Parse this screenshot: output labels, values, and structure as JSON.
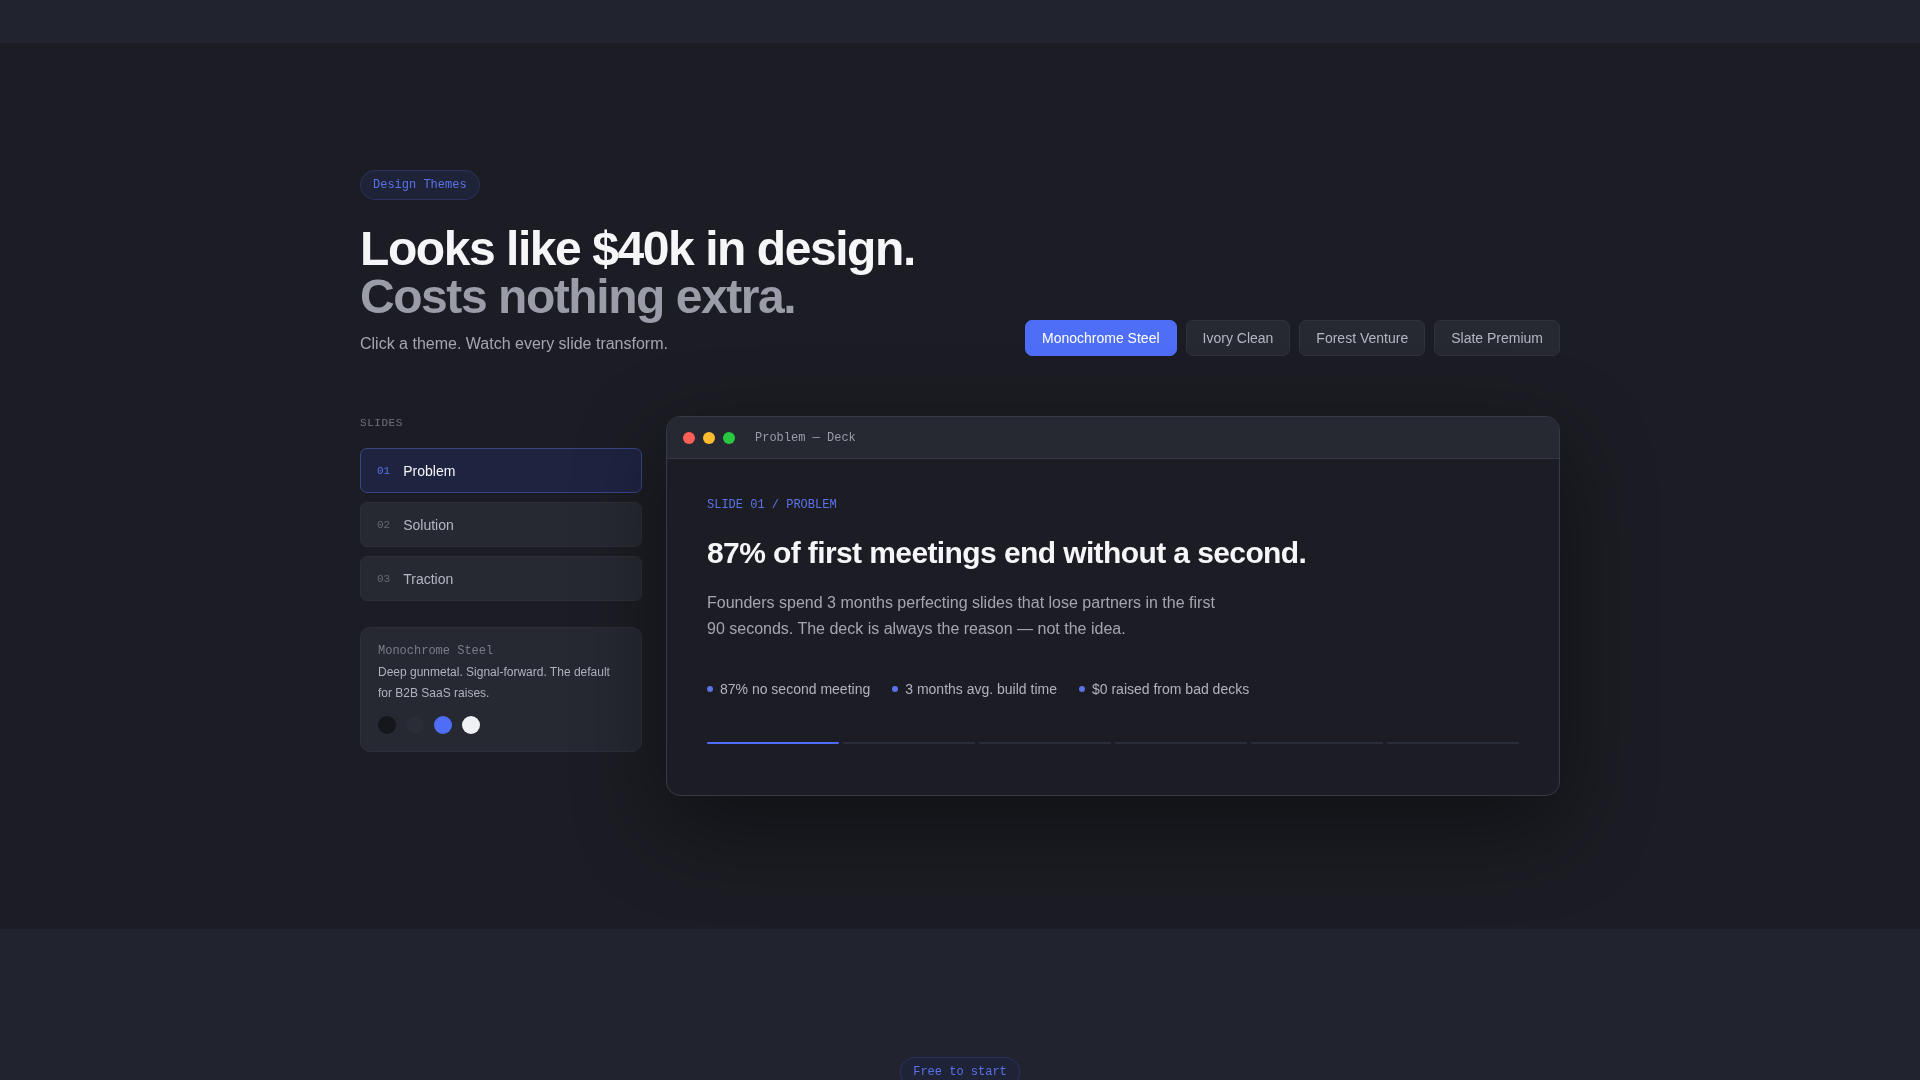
{
  "header": {
    "badge": "Design Themes",
    "title": "Looks like $40k in design.",
    "title_muted": "Costs nothing extra.",
    "subtitle": "Click a theme. Watch every slide transform."
  },
  "themes": [
    {
      "label": "Monochrome Steel",
      "selected": true
    },
    {
      "label": "Ivory Clean",
      "selected": false
    },
    {
      "label": "Forest Venture",
      "selected": false
    },
    {
      "label": "Slate Premium",
      "selected": false
    }
  ],
  "sidebar": {
    "heading": "SLIDES",
    "slides": [
      {
        "number": "01",
        "label": "Problem",
        "selected": true
      },
      {
        "number": "02",
        "label": "Solution",
        "selected": false
      },
      {
        "number": "03",
        "label": "Traction",
        "selected": false
      }
    ]
  },
  "theme_card": {
    "name": "Monochrome Steel",
    "description": "Deep gunmetal. Signal-forward. The default for B2B SaaS raises.",
    "swatches": [
      {
        "color": "#16171d"
      },
      {
        "color": "#2a2c37"
      },
      {
        "color": "#4f6ef7"
      },
      {
        "color": "#f0f1f5"
      }
    ]
  },
  "deck": {
    "window_title": "Problem — Deck",
    "eyebrow": "SLIDE 01 / PROBLEM",
    "headline": "87% of first meetings end without a second.",
    "body": "Founders spend 3 months perfecting slides that lose partners in the first 90 seconds. The deck is always the reason — not the idea.",
    "stats": [
      "87% no second meeting",
      "3 months avg. build time",
      "$0 raised from bad decks"
    ],
    "progress": [
      {
        "selected": true
      },
      {
        "selected": false
      },
      {
        "selected": false
      },
      {
        "selected": false
      },
      {
        "selected": false
      },
      {
        "selected": false
      }
    ]
  },
  "footer": {
    "badge": "Free to start"
  }
}
